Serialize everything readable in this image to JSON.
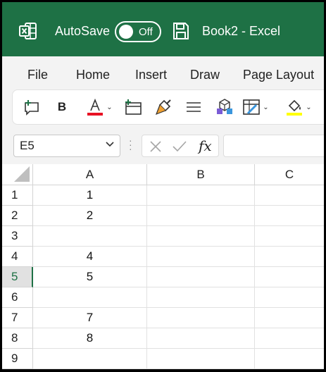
{
  "titlebar": {
    "app_icon": "excel-icon",
    "autosave_label": "AutoSave",
    "autosave_state": "Off",
    "save_icon": "save-icon",
    "doc_title": "Book2  -  Excel",
    "bg_color": "#1e7145"
  },
  "ribbon": {
    "tabs": [
      {
        "label": "File"
      },
      {
        "label": "Home"
      },
      {
        "label": "Insert"
      },
      {
        "label": "Draw"
      },
      {
        "label": "Page Layout"
      }
    ],
    "tools": [
      {
        "name": "new-comment-icon"
      },
      {
        "name": "bold-button",
        "label": "B"
      },
      {
        "name": "font-color-icon",
        "color": "#e81123"
      },
      {
        "name": "insert-sheet-icon"
      },
      {
        "name": "format-painter-icon"
      },
      {
        "name": "align-icon"
      },
      {
        "name": "cell-styles-icon"
      },
      {
        "name": "borders-icon"
      },
      {
        "name": "fill-color-icon",
        "color": "#ffff00"
      }
    ]
  },
  "formula_bar": {
    "name_box": "E5",
    "fx_label": "fx",
    "formula": ""
  },
  "grid": {
    "columns": [
      "A",
      "B",
      "C"
    ],
    "active_row": "5",
    "rows": [
      {
        "num": "1",
        "a": "1"
      },
      {
        "num": "2",
        "a": "2"
      },
      {
        "num": "3",
        "a": ""
      },
      {
        "num": "4",
        "a": "4"
      },
      {
        "num": "5",
        "a": "5"
      },
      {
        "num": "6",
        "a": ""
      },
      {
        "num": "7",
        "a": "7"
      },
      {
        "num": "8",
        "a": "8"
      },
      {
        "num": "9",
        "a": ""
      }
    ]
  }
}
